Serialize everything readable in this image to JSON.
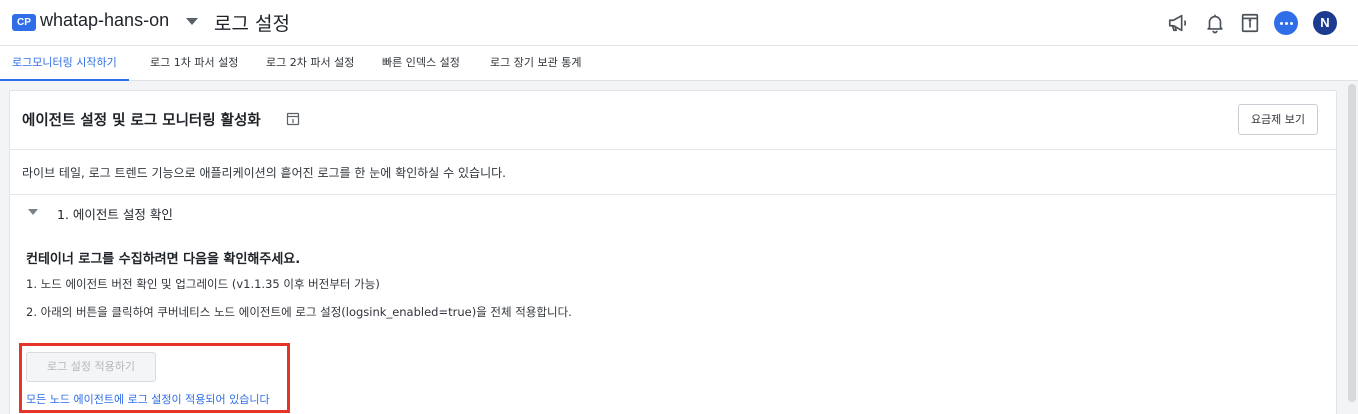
{
  "header": {
    "project_badge": "CP",
    "project_name": "whatap-hans-on",
    "page_title": "로그 설정",
    "icons": [
      "megaphone-icon",
      "bell-icon",
      "document-info-icon",
      "chat-icon"
    ],
    "avatar_initial": "N",
    "accent_color": "#2f6ee8"
  },
  "tabs": [
    {
      "label": "로그모니터링 시작하기",
      "active": true
    },
    {
      "label": "로그 1차 파서 설정",
      "active": false
    },
    {
      "label": "로그 2차 파서 설정",
      "active": false
    },
    {
      "label": "빠른 인덱스 설정",
      "active": false
    },
    {
      "label": "로그 장기 보관 통계",
      "active": false
    }
  ],
  "card": {
    "title": "에이전트 설정 및 로그 모니터링 활성화",
    "pricing_button": "요금제 보기",
    "description": "라이브 테일, 로그 트렌드 기능으로 애플리케이션의 흩어진 로그를 한 눈에 확인하실 수 있습니다.",
    "section": {
      "title": "1. 에이전트 설정 확인",
      "heading": "컨테이너 로그를 수집하려면 다음을 확인해주세요.",
      "step1": "1. 노드 에이전트 버전 확인 및 업그레이드 (v1.1.35 이후 버전부터 가능)",
      "step2": "2. 아래의 버튼을 클릭하여 쿠버네티스 노드 에이전트에 로그 설정(logsink_enabled=true)을 전체 적용합니다.",
      "apply_button": "로그 설정 적용하기",
      "apply_button_disabled": true,
      "status_message": "모든 노드 에이전트에 로그 설정이 적용되어 있습니다"
    }
  },
  "highlight_color": "#e5352b"
}
